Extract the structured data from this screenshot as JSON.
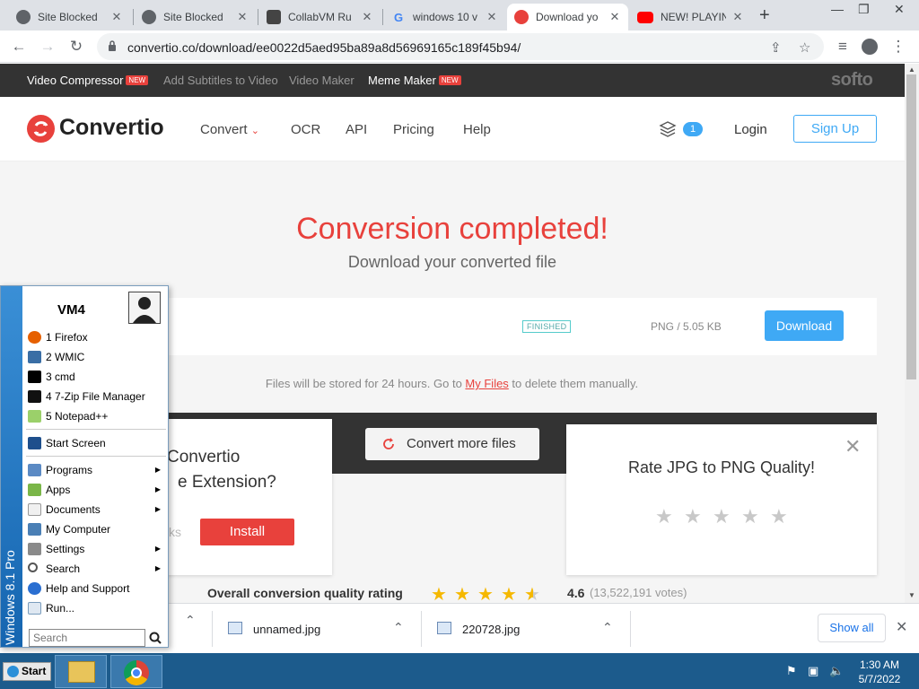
{
  "browser": {
    "tabs": [
      {
        "label": "Site Blocked",
        "icon": "globe-icon"
      },
      {
        "label": "Site Blocked",
        "icon": "globe-icon"
      },
      {
        "label": "CollabVM Ru",
        "icon": "collabvm-icon"
      },
      {
        "label": "windows 10 v",
        "icon": "google-icon"
      },
      {
        "label": "Download yo",
        "icon": "convertio-icon",
        "active": true
      },
      {
        "label": "NEW! PLAYIN",
        "icon": "youtube-icon"
      }
    ],
    "url": "convertio.co/download/ee0022d5aed95ba89a8d56969165c189f45b94/"
  },
  "softo_bar": {
    "items": [
      "Video Compressor",
      "Add Subtitles to Video",
      "Video Maker",
      "Meme Maker"
    ],
    "new_badge": "NEW",
    "logo": "softo"
  },
  "header": {
    "brand": "Convertio",
    "menu": [
      "Convert",
      "OCR",
      "API",
      "Pricing",
      "Help"
    ],
    "files_count": "1",
    "login": "Login",
    "signup": "Sign Up"
  },
  "main": {
    "title": "Conversion completed!",
    "subtitle": "Download your converted file",
    "file": {
      "status": "FINISHED",
      "size": "PNG / 5.05 KB",
      "download": "Download"
    },
    "stored_pre": "Files will be stored for 24 hours. Go to ",
    "stored_link": "My Files",
    "stored_post": " to delete them manually.",
    "convert_more": "Convert more files",
    "ext_card": {
      "line1": "Convertio",
      "line2": "e Extension?",
      "partial": "ks",
      "install": "Install"
    },
    "rate_card": {
      "title": "Rate JPG to PNG Quality!"
    },
    "overall_label": "Overall conversion quality rating",
    "overall_rating": 4.6,
    "score": "4.6",
    "votes": "(13,522,191 votes)"
  },
  "downloads": {
    "items": [
      "unnamed.jpg",
      "220728.jpg"
    ],
    "show_all": "Show all"
  },
  "start_menu": {
    "user": "VM4",
    "edition": "Windows 8.1 Pro",
    "pinned": [
      "1 Firefox",
      "2 WMIC",
      "3 cmd",
      "4 7-Zip File Manager",
      "5 Notepad++"
    ],
    "start_screen": "Start Screen",
    "items": [
      "Programs",
      "Apps",
      "Documents",
      "My Computer",
      "Settings",
      "Search",
      "Help and Support",
      "Run..."
    ],
    "search_placeholder": "Search"
  },
  "taskbar": {
    "start": "Start",
    "time": "1:30 AM",
    "date": "5/7/2022"
  },
  "colors": {
    "accent": "#e8413c",
    "blue": "#3fa9f5",
    "taskbar": "#1c5b8c"
  }
}
